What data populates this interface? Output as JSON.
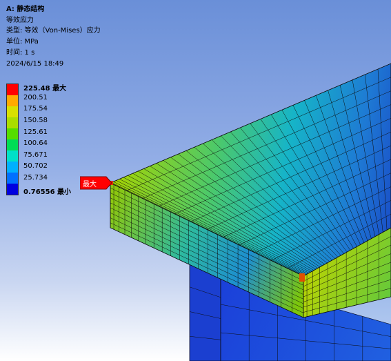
{
  "info": {
    "title": "A: 静态结构",
    "result_name": "等效应力",
    "type_line": "类型: 等效（Von-Mises）应力",
    "unit_line": "单位: MPa",
    "time_line": "时间: 1 s",
    "timestamp": "2024/6/15 18:49"
  },
  "legend": {
    "max_label": "225.48 最大",
    "values": [
      "200.51",
      "175.54",
      "150.58",
      "125.61",
      "100.64",
      "75.671",
      "50.702",
      "25.734"
    ],
    "min_label": "0.76556 最小",
    "colors": [
      "#ff0000",
      "#ffaa00",
      "#d8e000",
      "#aadd00",
      "#55dd00",
      "#00dd55",
      "#00e0c8",
      "#00b0ff",
      "#0070ff",
      "#0000e0"
    ]
  },
  "probe": {
    "label": "最大",
    "color": "#ff0000"
  }
}
